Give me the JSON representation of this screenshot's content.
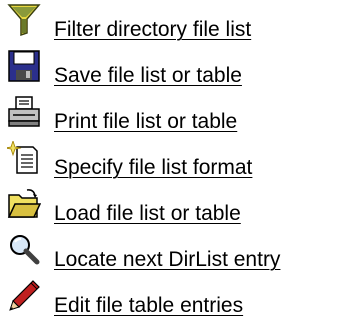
{
  "commands": [
    {
      "label": "Filter directory file list",
      "icon": "funnel-filter-icon"
    },
    {
      "label": "Save file list or table",
      "icon": "floppy-disk-save-icon"
    },
    {
      "label": "Print file list or table",
      "icon": "printer-icon"
    },
    {
      "label": "Specify file list format",
      "icon": "new-document-sparkle-icon"
    },
    {
      "label": "Load file list or table",
      "icon": "open-folder-icon"
    },
    {
      "label": "Locate next DirList entry",
      "icon": "magnifier-search-icon"
    },
    {
      "label": "Edit file table entries",
      "icon": "pencil-edit-icon"
    }
  ],
  "colors": {
    "text": "#000000",
    "background": "#ffffff",
    "funnel_green": "#7a8a3a",
    "funnel_yellow": "#e8d840",
    "disk_navy": "#2b2f8c",
    "printer_gray": "#c0c0c0",
    "folder_yellow": "#f0e060",
    "pencil_red": "#c02020"
  }
}
